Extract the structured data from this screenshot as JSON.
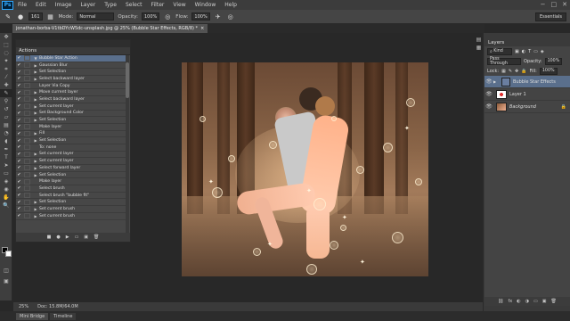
{
  "app": {
    "logo": "Ps"
  },
  "menu": [
    "File",
    "Edit",
    "Image",
    "Layer",
    "Type",
    "Select",
    "Filter",
    "View",
    "Window",
    "Help"
  ],
  "window_controls": [
    "−",
    "□",
    "✕"
  ],
  "options": {
    "brush_size": "161",
    "mode_label": "Mode:",
    "mode_value": "Normal",
    "opacity_label": "Opacity:",
    "opacity_value": "100%",
    "flow_label": "Flow:",
    "flow_value": "100%",
    "workspace": "Essentials"
  },
  "document": {
    "tab_title": "jonathan-borba-V1tbDYcW5dc-unsplash.jpg @ 25% (Bubble Star Effects, RGB/8) *",
    "close": "×"
  },
  "actions": {
    "tab_label": "Actions",
    "items": [
      {
        "label": "Bubble Star Action",
        "triangle": "▼",
        "selected": true
      },
      {
        "label": "Gaussian Blur",
        "triangle": "▶"
      },
      {
        "label": "Set Selection",
        "triangle": "▶"
      },
      {
        "label": "Select backward layer",
        "triangle": "▶"
      },
      {
        "label": "Layer Via Copy",
        "triangle": ""
      },
      {
        "label": "Move current layer",
        "triangle": "▶"
      },
      {
        "label": "Select backward layer",
        "triangle": "▶"
      },
      {
        "label": "Set current layer",
        "triangle": "▶"
      },
      {
        "label": "Set Background Color",
        "triangle": "▶"
      },
      {
        "label": "Set Selection",
        "triangle": "▶"
      },
      {
        "label": "Make layer",
        "triangle": ""
      },
      {
        "label": "Fill",
        "triangle": "▶"
      },
      {
        "label": "Set Selection",
        "triangle": "▶"
      },
      {
        "label": "To: none",
        "triangle": ""
      },
      {
        "label": "Set current layer",
        "triangle": "▶"
      },
      {
        "label": "Set current layer",
        "triangle": "▶"
      },
      {
        "label": "Select forward layer",
        "triangle": "▶"
      },
      {
        "label": "Set Selection",
        "triangle": "▶"
      },
      {
        "label": "Make layer",
        "triangle": ""
      },
      {
        "label": "Select brush",
        "triangle": ""
      },
      {
        "label": "Select brush \"bubble fit\"",
        "triangle": ""
      },
      {
        "label": "Set Selection",
        "triangle": "▶"
      },
      {
        "label": "Set current brush",
        "triangle": "▶"
      },
      {
        "label": "Set current brush",
        "triangle": "▶"
      }
    ],
    "footer_icons": [
      "■",
      "●",
      "▶",
      "▭",
      "▣",
      "🗑"
    ]
  },
  "status": {
    "zoom": "25%",
    "doc_info": "Doc: 15.8M/64.0M"
  },
  "bottom_tabs": [
    "Mini Bridge",
    "Timeline"
  ],
  "layers": {
    "tab_label": "Layers",
    "kind_label": "Kind",
    "blend_mode": "Pass Through",
    "opacity_label": "Opacity:",
    "opacity_value": "100%",
    "lock_label": "Lock:",
    "fill_label": "Fill:",
    "fill_value": "100%",
    "items": [
      {
        "name": "Bubble Star Effects",
        "type": "group",
        "selected": true
      },
      {
        "name": "Layer 1",
        "type": "layer"
      },
      {
        "name": "Background",
        "type": "background"
      }
    ],
    "footer_icons": [
      "⛓",
      "fx",
      "◐",
      "◑",
      "▭",
      "▣",
      "🗑"
    ]
  }
}
